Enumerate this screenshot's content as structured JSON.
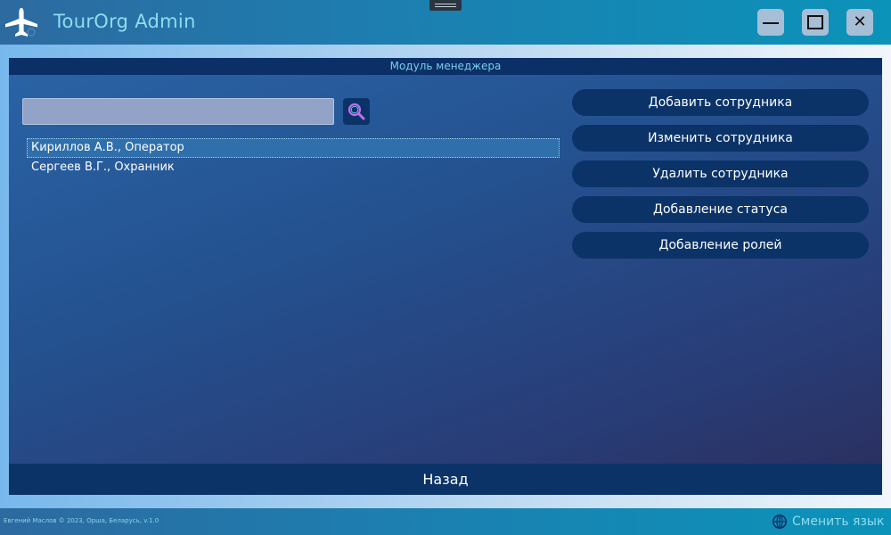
{
  "window": {
    "title": "TourOrg Admin",
    "logo_icon": "airplane-icon",
    "controls": {
      "minimize_icon": "minimize-icon",
      "maximize_icon": "maximize-icon",
      "close_icon": "close-icon",
      "close_glyph": "✕"
    }
  },
  "module": {
    "header": "Модуль менеджера"
  },
  "search": {
    "value": "",
    "placeholder": "",
    "icon": "search-icon"
  },
  "employees": [
    {
      "label": "Кириллов А.В., Оператор",
      "selected": true
    },
    {
      "label": "Сергеев В.Г., Охранник",
      "selected": false
    }
  ],
  "actions": [
    "Добавить сотрудника",
    "Изменить сотрудника",
    "Удалить сотрудника",
    "Добавление статуса",
    "Добавление ролей"
  ],
  "back_label": "Назад",
  "footer": {
    "copyright": "Евгений Маслов © 2023, Орша, Беларусь, v.1.0",
    "language_label": "Сменить язык",
    "language_icon": "globe-icon"
  },
  "colors": {
    "title_text": "#8fdcf0",
    "dark_button": "#0b3368",
    "panel_header_bg": "#0b2f67",
    "window_control_bg": "#a6bfd7"
  }
}
